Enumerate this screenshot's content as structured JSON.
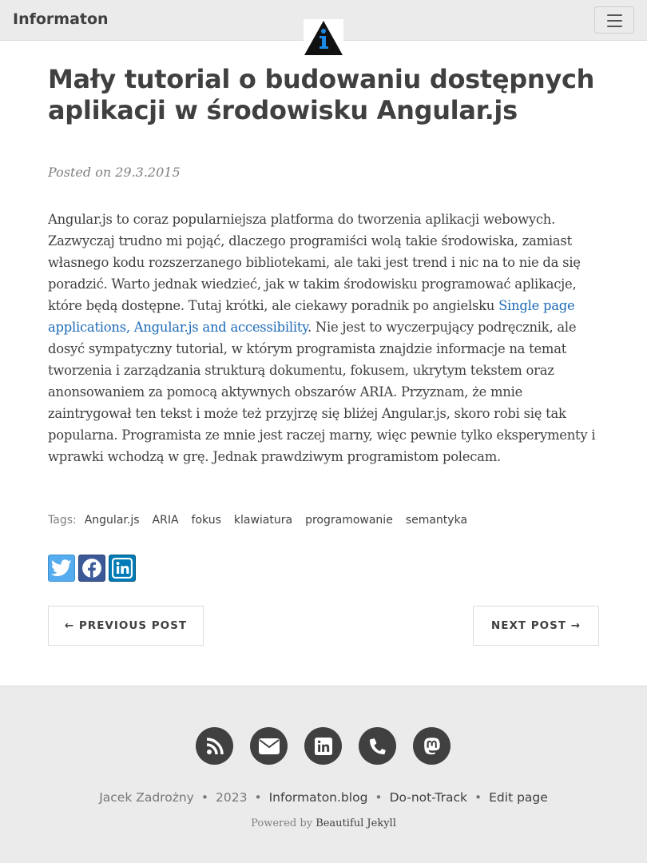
{
  "navbar": {
    "brand": "Informaton",
    "menu_icon": "hamburger-icon",
    "logo_icon": "info-triangle-icon"
  },
  "post": {
    "title": "Mały tutorial o budowaniu dostępnych aplikacji w środowisku Angular.js",
    "meta": "Posted on 29.3.2015",
    "body_before_link": "Angular.js to coraz popularniejsza platforma do tworzenia aplikacji webowych. Zazwyczaj trudno mi pojąć, dlaczego programiści wolą takie środowiska, zamiast własnego kodu rozszerzanego bibliotekami, ale taki jest trend i nic na to nie da się poradzić. Warto jednak wiedzieć, jak w takim środowisku programować aplikacje, które będą dostępne. Tutaj krótki, ale ciekawy poradnik po angielsku ",
    "link_text": "Single page applications, Angular.js and accessibility",
    "body_after_link": ". Nie jest to wyczerpujący podręcznik, ale dosyć sympatyczny tutorial, w którym programista znajdzie informacje na temat tworzenia i zarządzania strukturą dokumentu, fokusem, ukrytym tekstem oraz anonsowaniem za pomocą aktywnych obszarów ARIA. Przyznam, że mnie zaintrygował ten tekst i może też przyjrzę się bliżej Angular.js, skoro robi się tak popularna. Programista ze mnie jest raczej marny, więc pewnie tylko eksperymenty i wprawki wchodzą w grę. Jednak prawdziwym programistom polecam.",
    "link_color": "#1e6bb8"
  },
  "tags": {
    "label": "Tags:",
    "items": [
      "Angular.js",
      "ARIA",
      "fokus",
      "klawiatura",
      "programowanie",
      "semantyka"
    ]
  },
  "share": {
    "buttons": [
      {
        "icon": "twitter-icon",
        "color": "#55acee"
      },
      {
        "icon": "facebook-icon",
        "color": "#3b5998"
      },
      {
        "icon": "linkedin-icon",
        "color": "#007bb5"
      }
    ]
  },
  "pager": {
    "previous": "← PREVIOUS POST",
    "next": "NEXT POST →"
  },
  "footer": {
    "icons": [
      "rss-icon",
      "email-icon",
      "linkedin-icon",
      "phone-icon",
      "mastodon-icon"
    ],
    "author": "Jacek Zadrożny",
    "year": "2023",
    "site": "Informaton.blog",
    "dnt": "Do-not-Track",
    "edit": "Edit page",
    "separator": "•",
    "powered_prefix": "Powered by",
    "powered_link": "Beautiful Jekyll"
  }
}
